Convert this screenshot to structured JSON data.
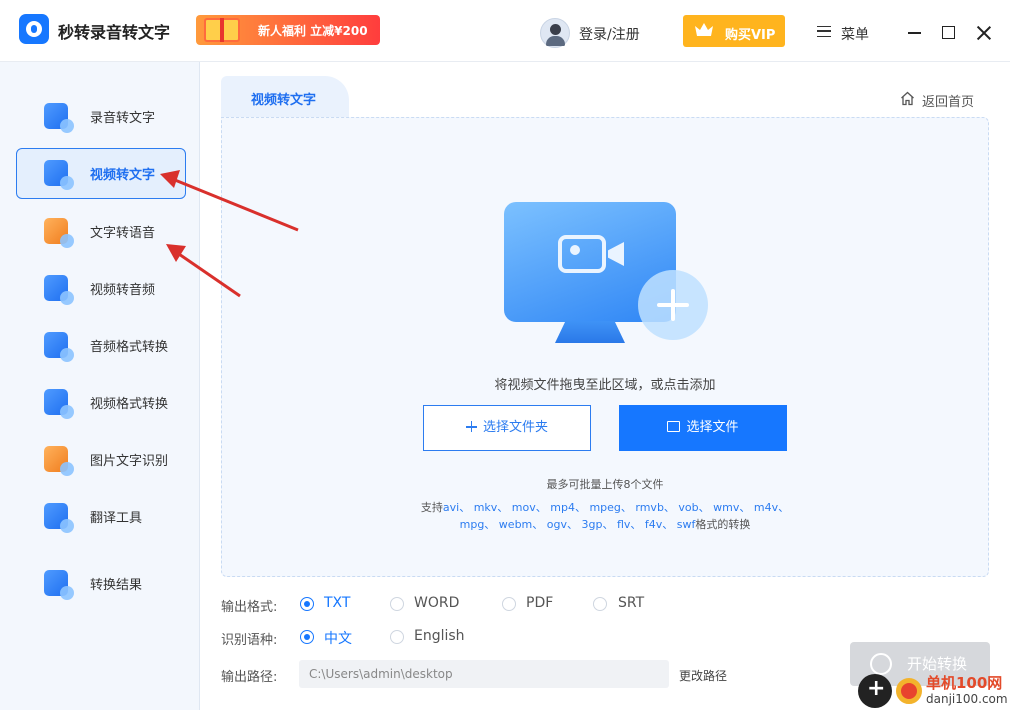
{
  "app": {
    "title": "秒转录音转文字",
    "promo": "新人福利 立减¥200",
    "login": "登录/注册",
    "vip": "购买VIP",
    "menu": "菜单"
  },
  "sidebar": {
    "items": [
      {
        "label": "录音转文字",
        "icon": "mic-text-icon",
        "active": false
      },
      {
        "label": "视频转文字",
        "icon": "video-text-icon",
        "active": true
      },
      {
        "label": "文字转语音",
        "icon": "text-speech-icon",
        "active": false
      },
      {
        "label": "视频转音频",
        "icon": "video-audio-icon",
        "active": false
      },
      {
        "label": "音频格式转换",
        "icon": "audio-convert-icon",
        "active": false
      },
      {
        "label": "视频格式转换",
        "icon": "video-convert-icon",
        "active": false
      },
      {
        "label": "图片文字识别",
        "icon": "image-ocr-icon",
        "active": false
      },
      {
        "label": "翻译工具",
        "icon": "translate-icon",
        "active": false
      },
      {
        "label": "转换结果",
        "icon": "result-icon",
        "active": false
      }
    ]
  },
  "main": {
    "tab": "视频转文字",
    "home_link": "返回首页",
    "drop_hint": "将视频文件拖曳至此区域，或点击添加",
    "btn_folder": "选择文件夹",
    "btn_file": "选择文件",
    "max_hint": "最多可批量上传8个文件",
    "support_prefix": "支持",
    "support_formats": "avi、 mkv、 mov、 mp4、 mpeg、 rmvb、 vob、 wmv、 m4v、 mpg、 webm、 ogv、 3gp、 flv、 f4v、 swf",
    "support_suffix": "格式的转换"
  },
  "options": {
    "format_label": "输出格式:",
    "formats": [
      "TXT",
      "WORD",
      "PDF",
      "SRT"
    ],
    "format_selected": "TXT",
    "lang_label": "识别语种:",
    "langs": [
      "中文",
      "English"
    ],
    "lang_selected": "中文",
    "path_label": "输出路径:",
    "path_value": "C:\\Users\\admin\\desktop",
    "change_path": "更改路径",
    "start": "开始转换"
  },
  "watermark": {
    "site": "单机100网",
    "url": "danji100.com"
  },
  "colors": {
    "accent": "#1677ff",
    "vip": "#ffb41e",
    "arrow": "#d9302c"
  }
}
